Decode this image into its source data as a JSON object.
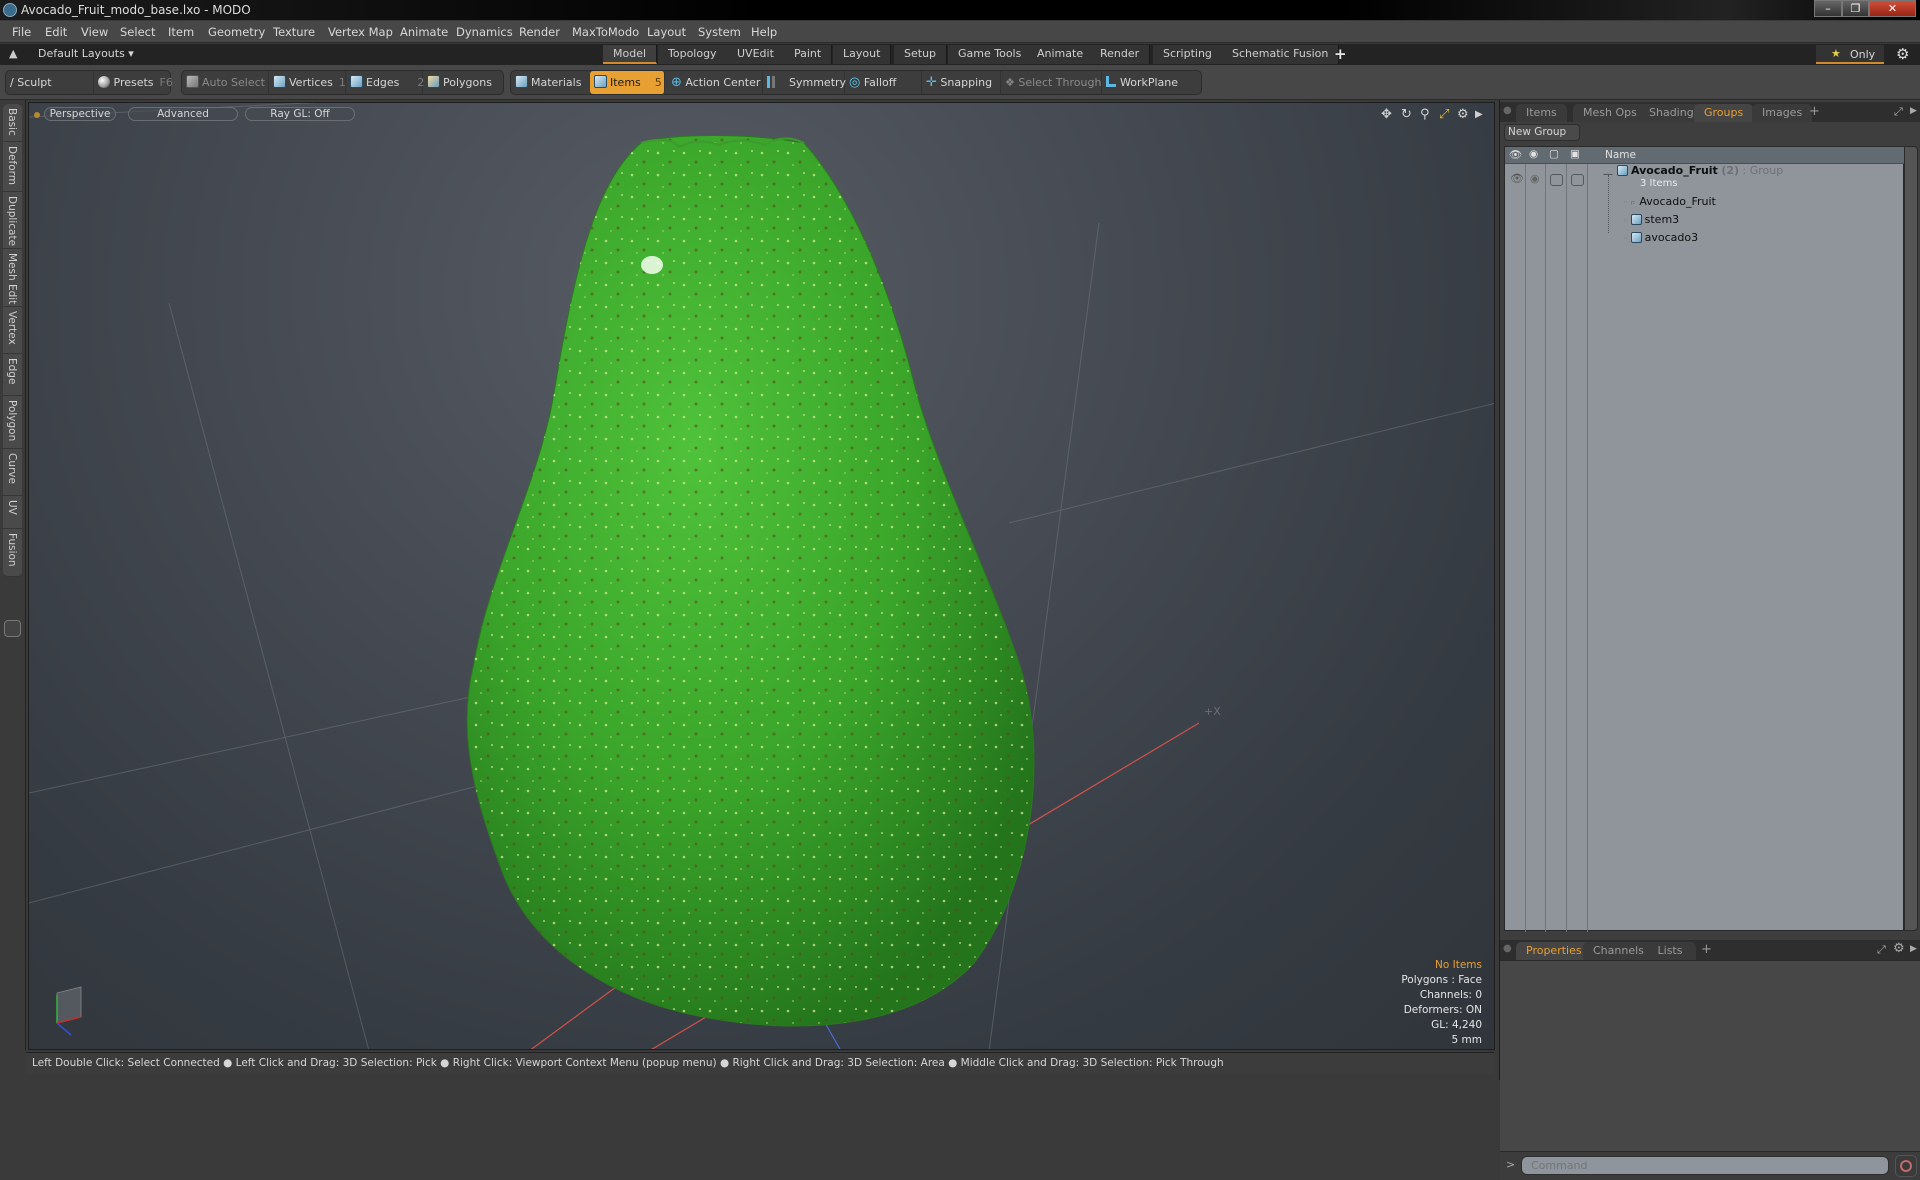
{
  "window": {
    "title": "Avocado_Fruit_modo_base.lxo - MODO",
    "controls": {
      "minimize": "–",
      "restore": "❐",
      "close": "✕"
    }
  },
  "menubar": {
    "items": [
      "File",
      "Edit",
      "View",
      "Select",
      "Item",
      "Geometry",
      "Texture",
      "Vertex Map",
      "Animate",
      "Dynamics",
      "Render",
      "MaxToModo",
      "Layout",
      "System",
      "Help"
    ]
  },
  "layoutbar": {
    "layout_dropdown": "Default Layouts ▾",
    "tabs": [
      "Model",
      "Topology",
      "UVEdit",
      "Paint",
      "Layout",
      "Setup",
      "Game Tools",
      "Animate",
      "Render",
      "Scripting",
      "Schematic Fusion"
    ],
    "active_tab": "Model",
    "add_tab": "+",
    "only_label": "Only",
    "star": "★"
  },
  "toolbar": {
    "sculpt": "Sculpt",
    "presets": "Presets",
    "presets_key": "F6",
    "auto_select": "Auto Select",
    "vertices": "Vertices",
    "vertices_key": "1",
    "edges": "Edges",
    "edges_key": "2",
    "polygons": "Polygons",
    "materials": "Materials",
    "items": "Items",
    "items_key": "5",
    "action_center": "Action Center",
    "symmetry": "Symmetry",
    "falloff": "Falloff",
    "snapping": "Snapping",
    "select_through": "Select Through",
    "workplane": "WorkPlane"
  },
  "left_tabs": [
    "Basic",
    "Deform",
    "Duplicate",
    "Mesh Edit",
    "Vertex",
    "Edge",
    "Polygon",
    "Curve",
    "UV",
    "Fusion"
  ],
  "viewport": {
    "view_mode": "Perspective",
    "shading": "Advanced",
    "raygl": "Ray GL: Off",
    "axis_label": "+X",
    "info": {
      "selection": "No Items",
      "polygons": "Polygons : Face",
      "channels": "Channels: 0",
      "deformers": "Deformers: ON",
      "gl": "GL: 4,240",
      "scale": "5 mm"
    },
    "colors": {
      "selection_info": "#e8a032"
    }
  },
  "statusbar": {
    "hints": [
      "Left Double Click: Select Connected",
      "Left Click and Drag: 3D Selection: Pick",
      "Right Click: Viewport Context Menu (popup menu)",
      "Right Click and Drag: 3D Selection: Area",
      "Middle Click and Drag: 3D Selection: Pick Through"
    ],
    "separator": "●"
  },
  "right_panel": {
    "top_tabs": [
      "Items",
      "Mesh Ops",
      "Shading",
      "Groups",
      "Images"
    ],
    "active_top_tab": "Groups",
    "add_tab": "+",
    "new_group_button": "New Group",
    "columns": {
      "name": "Name"
    },
    "group": {
      "name": "Avocado_Fruit",
      "count": "(2)",
      "type": ": Group",
      "subtitle": "3 Items",
      "children": [
        "Avocado_Fruit",
        "stem3",
        "avocado3"
      ]
    },
    "bottom_tabs": [
      "Properties",
      "Channels",
      "Lists"
    ],
    "active_bottom_tab": "Properties",
    "command_placeholder": "Command",
    "command_prompt": ">"
  },
  "colors": {
    "accent": "#e8a032",
    "viewport_bg": "#3d434a",
    "avocado": "#3aa52a"
  }
}
